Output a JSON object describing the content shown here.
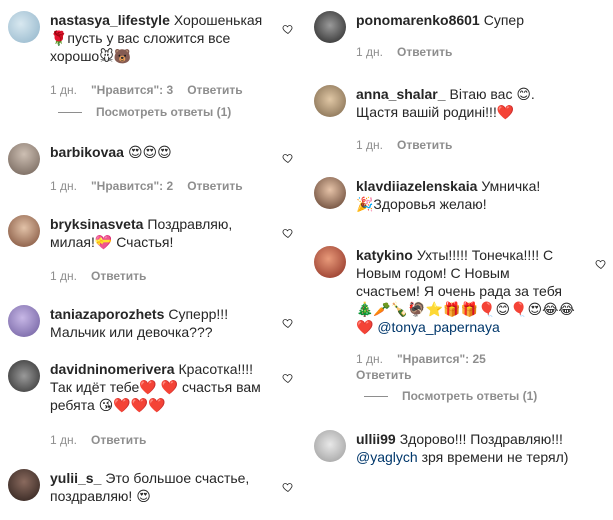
{
  "labels": {
    "day": "1 дн.",
    "likes_prefix": "\"Нравится\": ",
    "reply": "Ответить"
  },
  "left": [
    {
      "username": "nastasya_lifestyle",
      "text_1": "Хорошенькая",
      "text_2": "🌹пусть у вас сложится все",
      "text_3": "хорошо🐭🐻",
      "likes": "\"Нравится\": 3",
      "replies": "Посмотреть ответы (1)",
      "avatar_color": "#8fb3c9"
    },
    {
      "username": "barbikovaa",
      "text_1": "😍😍😍",
      "likes": "\"Нравится\": 2",
      "avatar_color": "#7a6a5e"
    },
    {
      "username": "bryksinasveta",
      "text_1": "Поздравляю,",
      "text_2": "милая!💝 Счастья!",
      "avatar_color": "#8a5a44"
    },
    {
      "username": "taniazaporozhets",
      "text_1": "Суперр!!!",
      "text_2": "Мальчик или девочка???",
      "avatar_color": "#8f7cb8"
    },
    {
      "username": "davidninomerivera",
      "text_1": "Красотка!!!!",
      "text_2": "Так идёт тебе❤️ ❤️ счастья вам",
      "text_3": "ребята 😘❤️❤️❤️",
      "avatar_color": "#4a4a4a"
    },
    {
      "username": "yulii_s_",
      "text_1": "Это большое счастье,",
      "text_2": "поздравляю! 😍",
      "avatar_color": "#3d2e2a"
    }
  ],
  "right": [
    {
      "username": "ponomarenko8601",
      "text_1": "Супер",
      "avatar_color": "#3a3a3a"
    },
    {
      "username": "anna_shalar_",
      "text_1": "Вітаю вас 😊.",
      "text_2": "Щастя вашій родині!!!❤️",
      "avatar_color": "#a08a6c"
    },
    {
      "username": "klavdiiazelenskaia",
      "text_1": "Умничка!",
      "text_2": "🎉Здоровья желаю!",
      "avatar_color": "#6b4a3a"
    },
    {
      "username": "katykino",
      "text_1": "Ухты!!!!! Тонечка!!!! С",
      "text_2": "Новым годом! С Новым",
      "text_3": "счастьем! Я очень рада за тебя",
      "text_4": "🎄🥕🍾🦃⭐🎁🎁🎈😊🎈😍😂😂",
      "text_5a": "❤️",
      "text_5b": "@tonya_papernaya",
      "likes": "\"Нравится\": 25",
      "replies": "Посмотреть ответы (1)",
      "avatar_color": "#9a3b2c"
    },
    {
      "username": "ullii99",
      "text_1": "Здорово!!! Поздравляю!!!",
      "text_2a": "@yaglych",
      "text_2b": "зря времени не терял)",
      "avatar_color": "#b8b8b8"
    }
  ]
}
